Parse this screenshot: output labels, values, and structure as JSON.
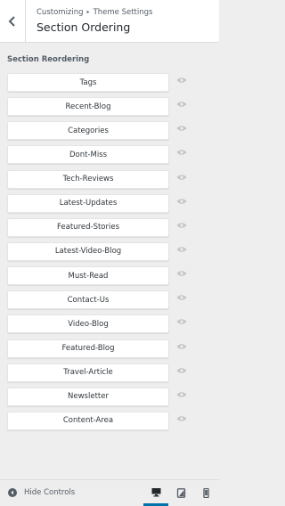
{
  "header": {
    "breadcrumb_root": "Customizing",
    "breadcrumb_separator": "▸",
    "breadcrumb_current": "Theme Settings",
    "title": "Section Ordering",
    "back_icon": "chevron-left-icon"
  },
  "section": {
    "label": "Section Reordering"
  },
  "sections": [
    {
      "label": "Tags"
    },
    {
      "label": "Recent-Blog"
    },
    {
      "label": "Categories"
    },
    {
      "label": "Dont-Miss"
    },
    {
      "label": "Tech-Reviews"
    },
    {
      "label": "Latest-Updates"
    },
    {
      "label": "Featured-Stories"
    },
    {
      "label": "Latest-Video-Blog"
    },
    {
      "label": "Must-Read"
    },
    {
      "label": "Contact-Us"
    },
    {
      "label": "Video-Blog"
    },
    {
      "label": "Featured-Blog"
    },
    {
      "label": "Travel-Article"
    },
    {
      "label": "Newsletter"
    },
    {
      "label": "Content-Area"
    }
  ],
  "footer": {
    "hide_controls_label": "Hide Controls",
    "devices": [
      "desktop",
      "tablet",
      "mobile"
    ],
    "active_device": "desktop"
  },
  "colors": {
    "accent": "#0073aa",
    "panel_bg": "#eeeeee",
    "eye_icon": "#c3c4c7"
  }
}
